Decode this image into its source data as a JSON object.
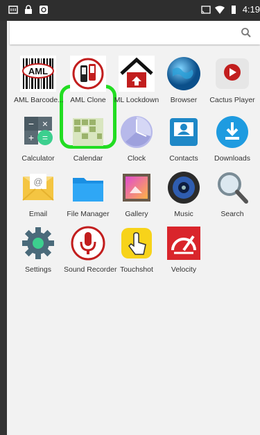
{
  "status_bar": {
    "time": "4:19",
    "left_icons": [
      "scan-icon",
      "lock-icon",
      "sync-icon"
    ],
    "right_icons": [
      "cast-icon",
      "wifi-icon",
      "battery-icon"
    ]
  },
  "search": {
    "placeholder": ""
  },
  "apps": [
    {
      "label": "AML Barcode...",
      "icon": "aml-barcode-icon"
    },
    {
      "label": "AML Clone",
      "icon": "aml-clone-icon",
      "highlighted": true
    },
    {
      "label": "ML Lockdown",
      "icon": "aml-lockdown-icon"
    },
    {
      "label": "Browser",
      "icon": "globe-icon"
    },
    {
      "label": "Cactus Player",
      "icon": "play-icon"
    },
    {
      "label": "Calculator",
      "icon": "calculator-icon"
    },
    {
      "label": "Calendar",
      "icon": "calendar-icon"
    },
    {
      "label": "Clock",
      "icon": "clock-icon"
    },
    {
      "label": "Contacts",
      "icon": "contacts-icon"
    },
    {
      "label": "Downloads",
      "icon": "download-icon"
    },
    {
      "label": "Email",
      "icon": "email-icon"
    },
    {
      "label": "File Manager",
      "icon": "folder-icon"
    },
    {
      "label": "Gallery",
      "icon": "gallery-icon"
    },
    {
      "label": "Music",
      "icon": "speaker-icon"
    },
    {
      "label": "Search",
      "icon": "magnifier-icon"
    },
    {
      "label": "Settings",
      "icon": "gear-icon"
    },
    {
      "label": "Sound Recorder",
      "icon": "microphone-icon"
    },
    {
      "label": "Touchshot",
      "icon": "hand-pointer-icon"
    },
    {
      "label": "Velocity",
      "icon": "velocity-icon"
    }
  ],
  "colors": {
    "highlight": "#22dd22",
    "drawer_bg": "#f2f2f2"
  }
}
